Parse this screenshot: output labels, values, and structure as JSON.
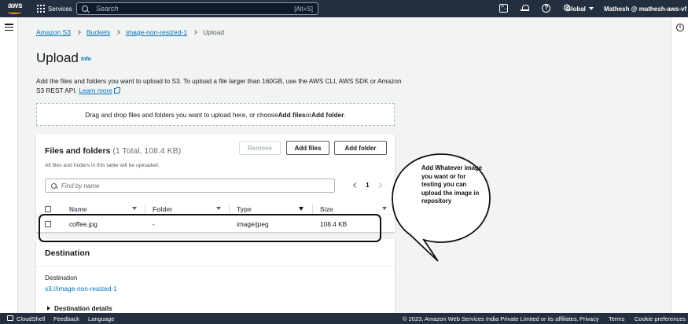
{
  "topnav": {
    "logo": "aws",
    "services_label": "Services",
    "search_placeholder": "Search",
    "search_shortcut": "[Alt+S]",
    "region_label": "Global",
    "account_label": "Mathesh @ mathesh-aws-vf",
    "icons": [
      "cloudshell-icon",
      "bell-icon",
      "help-icon",
      "gear-icon"
    ]
  },
  "breadcrumb": {
    "items": [
      "Amazon S3",
      "Buckets",
      "image-non-resized-1"
    ],
    "current": "Upload"
  },
  "page": {
    "title": "Upload",
    "info": "Info",
    "description": "Add the files and folders you want to upload to S3. To upload a file larger than 160GB, use the AWS CLI, AWS SDK or Amazon S3 REST API.",
    "learn_more": "Learn more"
  },
  "dropzone": {
    "prefix": "Drag and drop files and folders you want to upload here, or choose ",
    "add_files": "Add files",
    "or": " or ",
    "add_folder": "Add folder",
    "suffix": "."
  },
  "files_panel": {
    "title": "Files and folders",
    "count": "(1 Total, 108.4 KB)",
    "subtitle": "All files and folders in this table will be uploaded.",
    "remove_label": "Remove",
    "add_files_label": "Add files",
    "add_folder_label": "Add folder",
    "filter_placeholder": "Find by name",
    "page_number": "1",
    "columns": [
      "Name",
      "Folder",
      "Type",
      "Size"
    ],
    "rows": [
      {
        "name": "coffee.jpg",
        "folder": "-",
        "type": "image/jpeg",
        "size": "108.4 KB"
      }
    ]
  },
  "annotation": {
    "text": "Add Whatever image you want or for testing you can upload the image in repository"
  },
  "destination": {
    "title": "Destination",
    "label": "Destination",
    "link": "s3://image-non-resized-1",
    "details": "Destination details"
  },
  "footer": {
    "cloudshell": "CloudShell",
    "feedback": "Feedback",
    "language": "Language",
    "copyright": "© 2023, Amazon Web Services India Private Limited or its affiliates.",
    "privacy": "Privacy",
    "terms": "Terms",
    "cookies": "Cookie preferences"
  },
  "colors": {
    "nav_bg": "#232f3e",
    "link": "#0073bb",
    "accent": "#ff9900",
    "page_bg": "#f2f3f3"
  }
}
